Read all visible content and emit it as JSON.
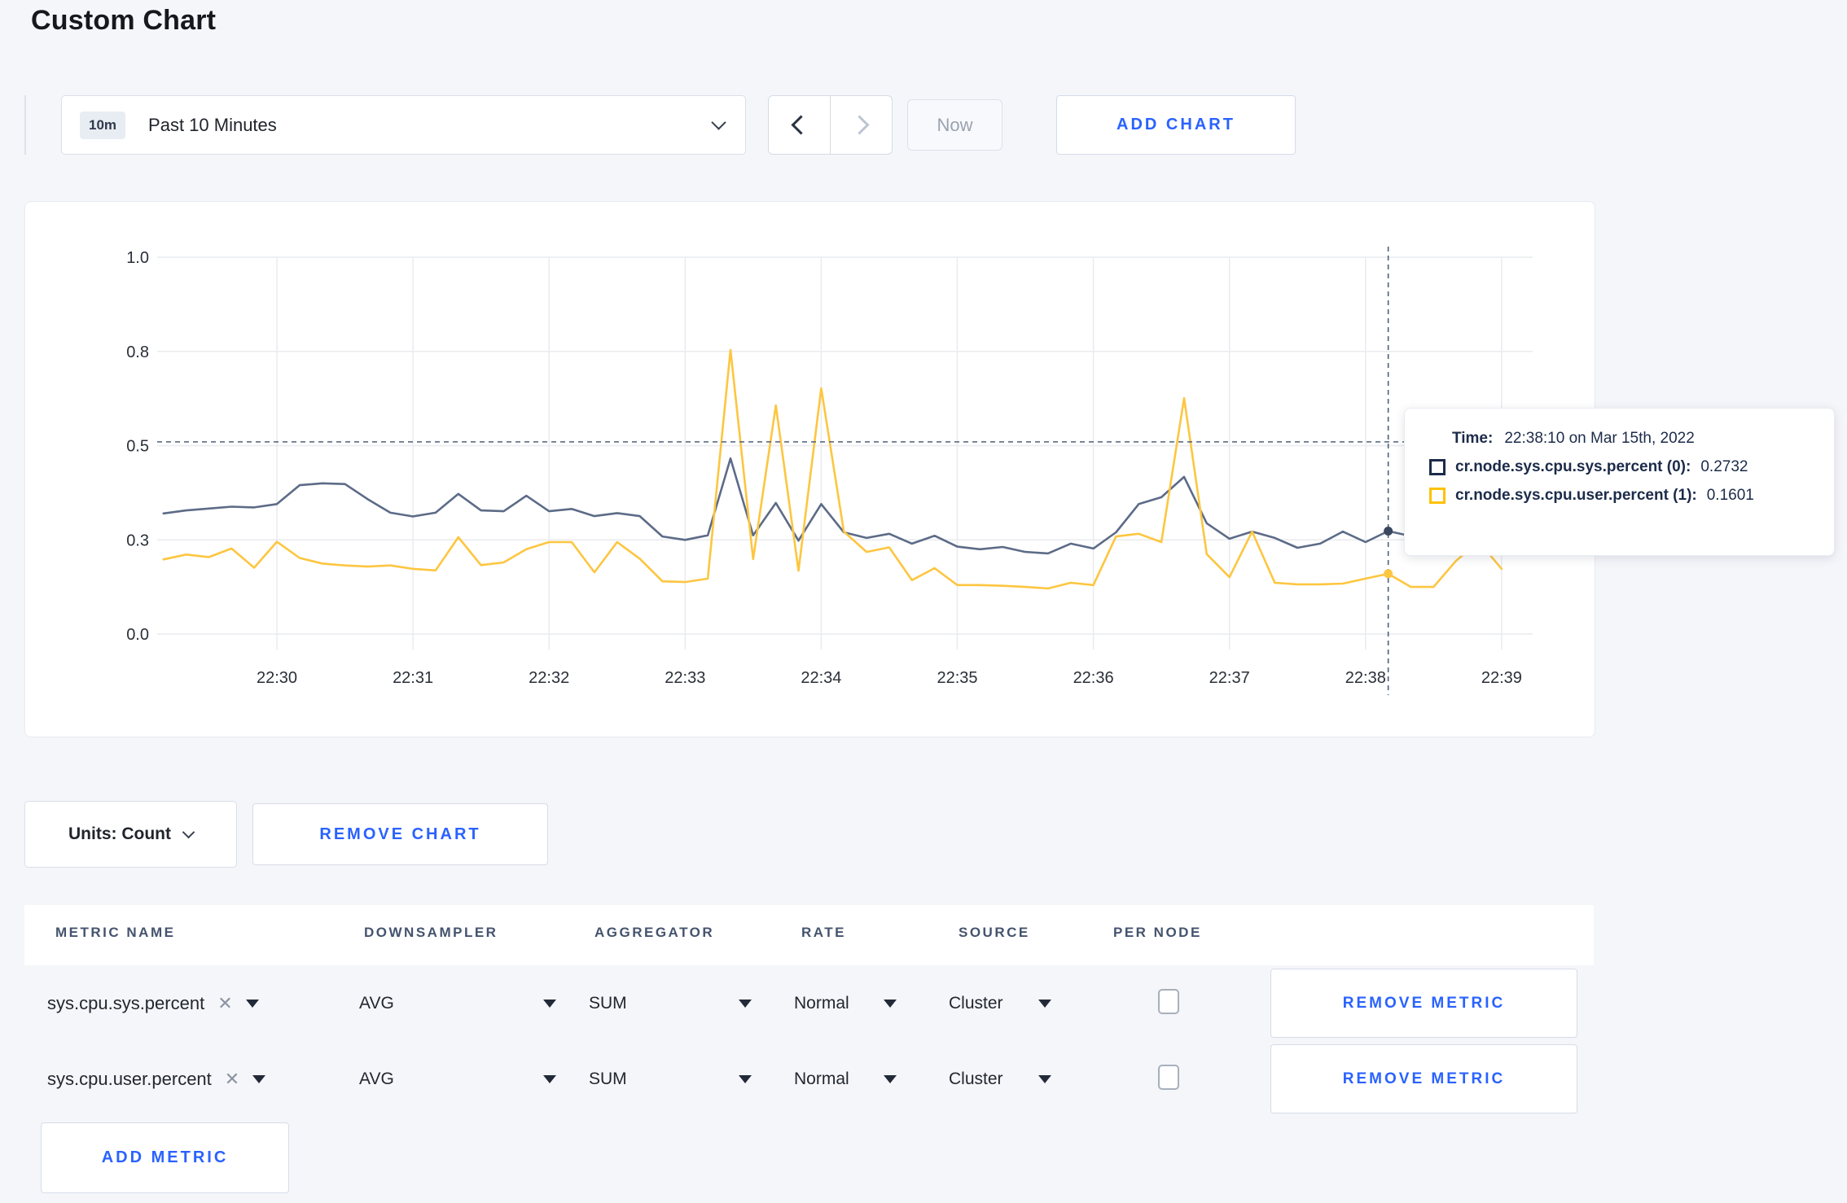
{
  "page": {
    "title": "Custom Chart"
  },
  "colors": {
    "accent": "#2962ff",
    "page_background": "#f5f6fa",
    "series_sys": "#5c6b87",
    "series_user": "#fdc640",
    "tooltip_swatch_sys": "#1c2b49",
    "tooltip_swatch_user": "#ffc106",
    "crosshair": "#4f6079",
    "gridline": "#e9ebef"
  },
  "toolbar": {
    "time_badge": "10m",
    "time_range": "Past 10 Minutes",
    "now_label": "Now",
    "add_chart_label": "ADD CHART"
  },
  "controls": {
    "units_label": "Units: Count",
    "remove_chart_label": "REMOVE CHART"
  },
  "tooltip": {
    "time_label": "Time:",
    "time_value": "22:38:10 on Mar 15th, 2022",
    "series": [
      {
        "label": "cr.node.sys.cpu.sys.percent (0):",
        "value": "0.2732"
      },
      {
        "label": "cr.node.sys.cpu.user.percent (1):",
        "value": "0.1601"
      }
    ]
  },
  "icons": {
    "close": "✕"
  },
  "table": {
    "headers": [
      "METRIC NAME",
      "DOWNSAMPLER",
      "AGGREGATOR",
      "RATE",
      "SOURCE",
      "PER NODE"
    ],
    "rows": [
      {
        "metric": "sys.cpu.sys.percent",
        "downsampler": "AVG",
        "aggregator": "SUM",
        "rate": "Normal",
        "source": "Cluster",
        "per_node_checked": false
      },
      {
        "metric": "sys.cpu.user.percent",
        "downsampler": "AVG",
        "aggregator": "SUM",
        "rate": "Normal",
        "source": "Cluster",
        "per_node_checked": false
      }
    ],
    "remove_metric_label": "REMOVE METRIC",
    "add_metric_label": "ADD METRIC"
  },
  "chart_data": {
    "type": "line",
    "x_start": "22:29:10",
    "x_interval_seconds": 10,
    "x_tick_labels": [
      "22:30",
      "22:31",
      "22:32",
      "22:33",
      "22:34",
      "22:35",
      "22:36",
      "22:37",
      "22:38",
      "22:39"
    ],
    "y_tick_labels": [
      "0.0",
      "0.3",
      "0.5",
      "0.8",
      "1.0"
    ],
    "y_tick_values": [
      0,
      0.25,
      0.5,
      0.75,
      1.0
    ],
    "ylim": [
      0,
      1
    ],
    "legend": "hidden (values shown in hover tooltip)",
    "series": [
      {
        "name": "cr.node.sys.cpu.sys.percent",
        "color": "#5c6b87",
        "values": [
          0.32,
          0.328,
          0.333,
          0.338,
          0.336,
          0.345,
          0.395,
          0.4,
          0.398,
          0.358,
          0.322,
          0.312,
          0.322,
          0.372,
          0.328,
          0.326,
          0.367,
          0.326,
          0.332,
          0.313,
          0.321,
          0.313,
          0.259,
          0.25,
          0.262,
          0.466,
          0.262,
          0.348,
          0.248,
          0.345,
          0.27,
          0.255,
          0.266,
          0.24,
          0.261,
          0.232,
          0.225,
          0.231,
          0.218,
          0.214,
          0.24,
          0.227,
          0.27,
          0.345,
          0.363,
          0.417,
          0.294,
          0.253,
          0.272,
          0.255,
          0.229,
          0.24,
          0.272,
          0.244,
          0.2732,
          0.26,
          0.268,
          0.262,
          0.266,
          0.27
        ]
      },
      {
        "name": "cr.node.sys.cpu.user.percent",
        "color": "#fdc640",
        "values": [
          0.198,
          0.211,
          0.204,
          0.227,
          0.176,
          0.245,
          0.202,
          0.187,
          0.182,
          0.179,
          0.182,
          0.173,
          0.169,
          0.257,
          0.183,
          0.19,
          0.225,
          0.244,
          0.244,
          0.164,
          0.244,
          0.2,
          0.14,
          0.138,
          0.147,
          0.754,
          0.199,
          0.607,
          0.168,
          0.652,
          0.272,
          0.218,
          0.23,
          0.143,
          0.175,
          0.13,
          0.13,
          0.128,
          0.125,
          0.121,
          0.136,
          0.13,
          0.259,
          0.266,
          0.244,
          0.626,
          0.212,
          0.151,
          0.272,
          0.136,
          0.132,
          0.132,
          0.134,
          0.147,
          0.1601,
          0.125,
          0.125,
          0.195,
          0.245,
          0.173
        ]
      }
    ],
    "hover": {
      "time": "22:38:10",
      "index": 54,
      "values": [
        0.2732,
        0.1601
      ],
      "crosshair_y": 0.51,
      "dot_colors": [
        "#39475f",
        "#fdc640"
      ]
    }
  }
}
